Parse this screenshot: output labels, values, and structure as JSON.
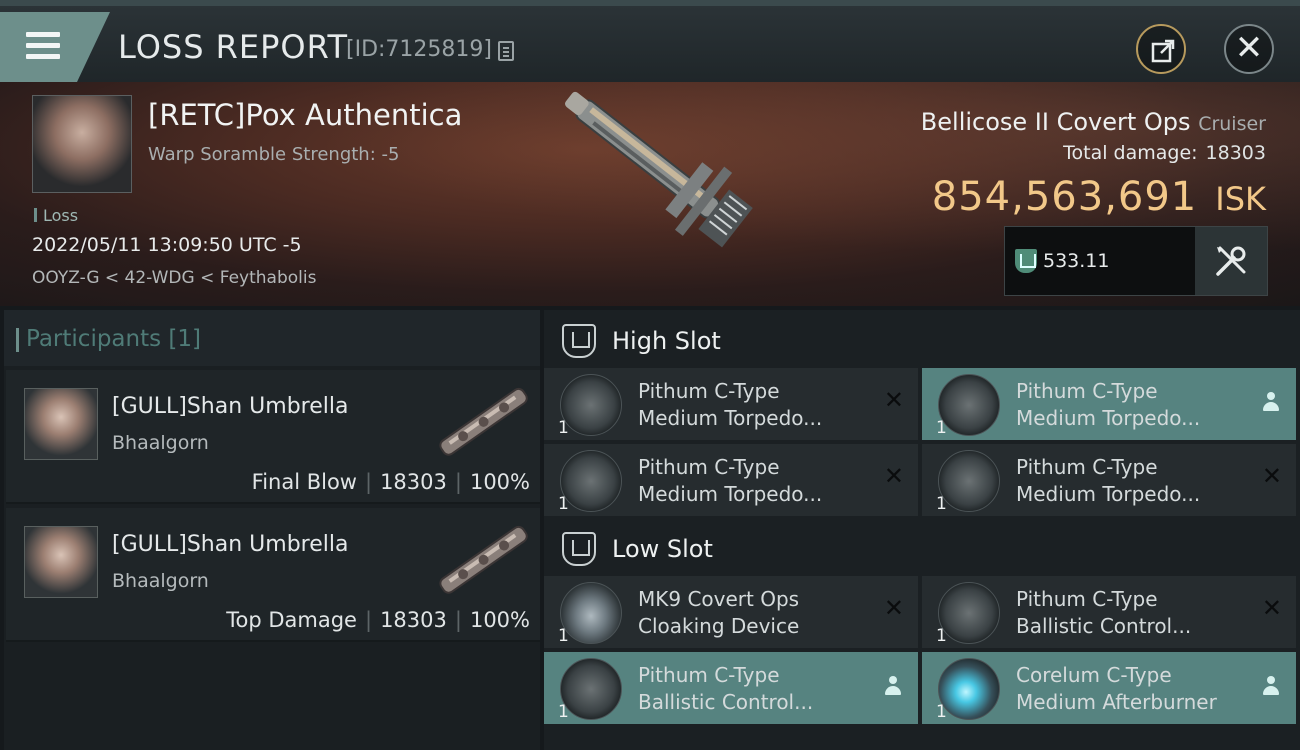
{
  "header": {
    "title": "LOSS REPORT",
    "report_id": "[ID:7125819]"
  },
  "victim": {
    "name": "[RETC]Pox Authentica",
    "subtitle": "Warp Soramble Strength: -5",
    "tag": "Loss",
    "timestamp": "2022/05/11 13:09:50 UTC -5",
    "location": "OOYZ-G < 42-WDG < Feythabolis",
    "ship_name": "Bellicose II Covert Ops",
    "ship_class": "Cruiser",
    "damage_label": "Total damage:",
    "damage_value": "18303",
    "isk_value": "854,563,691",
    "isk_unit": "ISK",
    "fit_value": "533.11"
  },
  "participants": {
    "title": "Participants",
    "count": "[1]",
    "items": [
      {
        "name": "[GULL]Shan Umbrella",
        "corp": "Bhaalgorn",
        "role": "Final Blow",
        "damage": "18303",
        "percent": "100%"
      },
      {
        "name": "[GULL]Shan Umbrella",
        "corp": "Bhaalgorn",
        "role": "Top Damage",
        "damage": "18303",
        "percent": "100%"
      }
    ]
  },
  "fitting": {
    "high_slot": {
      "title": "High Slot",
      "modules": [
        {
          "line1": "Pithum C-Type",
          "line2": "Medium Torpedo...",
          "qty": "1",
          "status": "destroyed",
          "icon": "torpedo-launcher-icon"
        },
        {
          "line1": "Pithum C-Type",
          "line2": "Medium Torpedo...",
          "qty": "1",
          "status": "dropped",
          "icon": "torpedo-launcher-icon"
        },
        {
          "line1": "Pithum C-Type",
          "line2": "Medium Torpedo...",
          "qty": "1",
          "status": "destroyed",
          "icon": "torpedo-launcher-icon"
        },
        {
          "line1": "Pithum C-Type",
          "line2": "Medium Torpedo...",
          "qty": "1",
          "status": "destroyed",
          "icon": "torpedo-launcher-icon"
        }
      ]
    },
    "low_slot": {
      "title": "Low Slot",
      "modules": [
        {
          "line1": "MK9 Covert Ops",
          "line2": "Cloaking Device",
          "qty": "1",
          "status": "destroyed",
          "icon": "cloaking-device-icon"
        },
        {
          "line1": "Pithum C-Type",
          "line2": "Ballistic Control...",
          "qty": "1",
          "status": "destroyed",
          "icon": "ballistic-control-icon"
        },
        {
          "line1": "Pithum C-Type",
          "line2": "Ballistic Control...",
          "qty": "1",
          "status": "dropped",
          "icon": "ballistic-control-icon"
        },
        {
          "line1": "Corelum C-Type",
          "line2": "Medium Afterburner",
          "qty": "1",
          "status": "dropped",
          "icon": "afterburner-icon"
        }
      ]
    }
  },
  "colors": {
    "accent": "#6d8f8b",
    "isk_gold": "#f2c889",
    "dropped_bg": "#568380",
    "destroyed_bg": "#262c2f"
  }
}
